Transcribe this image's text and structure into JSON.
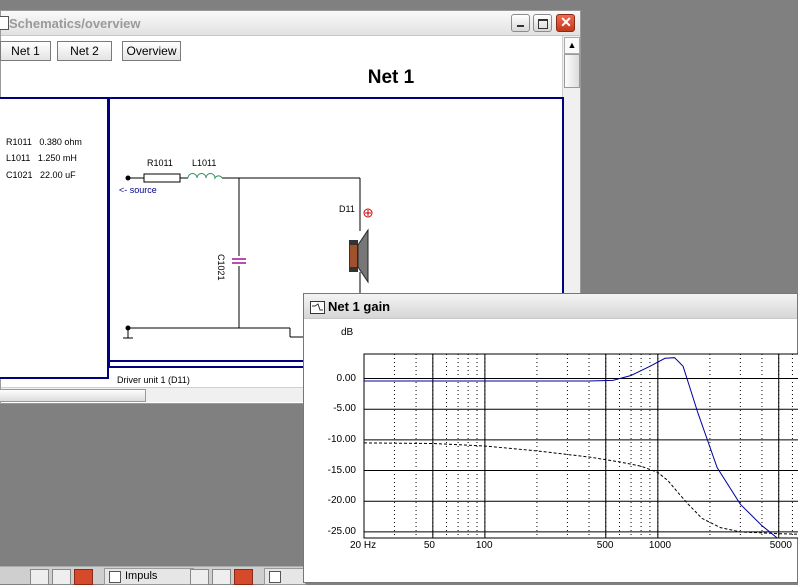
{
  "schematic_window": {
    "title": "Schematics/overview",
    "buttons": {
      "net1": "Net 1",
      "net2": "Net 2",
      "overview": "Overview"
    },
    "heading": "Net 1",
    "component_list": [
      {
        "ref": "R1011",
        "value": "0.380 ohm"
      },
      {
        "ref": "L1011",
        "value": "1.250 mH"
      },
      {
        "ref": "C1021",
        "value": "22.00 uF"
      }
    ],
    "schematic_labels": {
      "resistor": "R1011",
      "inductor": "L1011",
      "capacitor": "C1021",
      "driver": "D11",
      "source": "<- source"
    },
    "status_text": "Driver unit 1 (D11)"
  },
  "gain_window": {
    "title": "Net 1 gain",
    "y_unit": "dB"
  },
  "taskbar": {
    "item_label": "Impuls"
  },
  "chart_data": {
    "type": "line",
    "title": "",
    "xlabel": "",
    "ylabel": "dB",
    "x_scale": "log",
    "xlim": [
      20,
      7000
    ],
    "ylim": [
      -26,
      4
    ],
    "y_ticks": [
      0,
      -5,
      -10,
      -15,
      -20,
      -25
    ],
    "y_tick_labels": [
      "0.00",
      "-5.00",
      "-10.00",
      "-15.00",
      "-20.00",
      "-25.00"
    ],
    "x_ticks": [
      20,
      50,
      100,
      500,
      1000,
      5000
    ],
    "x_tick_labels": [
      "20 Hz",
      "50",
      "100",
      "500",
      "1000",
      "5000"
    ],
    "grid": true,
    "series": [
      {
        "style": "solid",
        "color": "#0000a0",
        "x": [
          20,
          100,
          400,
          550,
          700,
          900,
          1100,
          1250,
          1400,
          1700,
          2200,
          3000,
          4000,
          4900
        ],
        "y": [
          -0.4,
          -0.4,
          -0.4,
          -0.3,
          0.5,
          2.0,
          3.3,
          3.4,
          2.0,
          -5.5,
          -14.5,
          -20.5,
          -24.0,
          -26.0
        ]
      },
      {
        "style": "dashed",
        "color": "#000000",
        "x": [
          20,
          50,
          100,
          200,
          400,
          600,
          800,
          1000,
          1150,
          1300,
          1500,
          1800,
          2300,
          3000,
          5000,
          7000
        ],
        "y": [
          -10.5,
          -10.6,
          -11.0,
          -11.8,
          -12.8,
          -13.6,
          -14.3,
          -15.3,
          -16.7,
          -18.5,
          -20.5,
          -22.8,
          -24.3,
          -25.0,
          -25.3,
          -25.4
        ]
      }
    ]
  }
}
